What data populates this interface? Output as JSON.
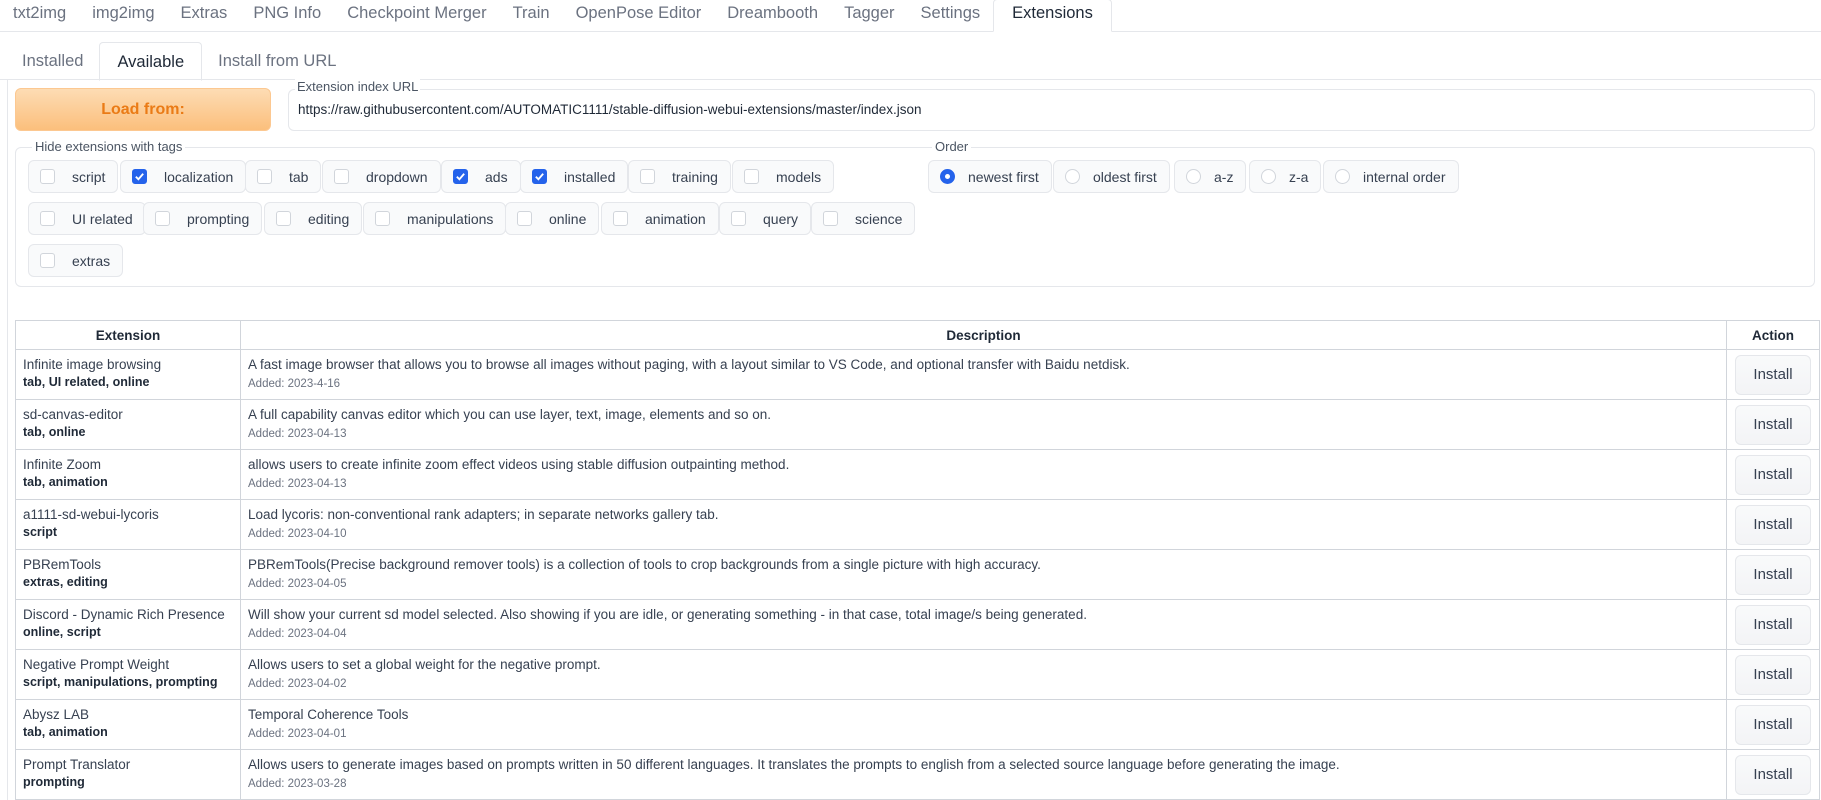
{
  "top_tabs": [
    "txt2img",
    "img2img",
    "Extras",
    "PNG Info",
    "Checkpoint Merger",
    "Train",
    "OpenPose Editor",
    "Dreambooth",
    "Tagger",
    "Settings",
    "Extensions"
  ],
  "active_top_tab": "Extensions",
  "sub_tabs": [
    "Installed",
    "Available",
    "Install from URL"
  ],
  "active_sub_tab": "Available",
  "load_button": "Load from:",
  "url_field": {
    "label": "Extension index URL",
    "value": "https://raw.githubusercontent.com/AUTOMATIC1111/stable-diffusion-webui-extensions/master/index.json"
  },
  "hide_tags": {
    "label": "Hide extensions with tags",
    "items": [
      {
        "label": "script",
        "checked": false
      },
      {
        "label": "localization",
        "checked": true
      },
      {
        "label": "tab",
        "checked": false
      },
      {
        "label": "dropdown",
        "checked": false
      },
      {
        "label": "ads",
        "checked": true
      },
      {
        "label": "installed",
        "checked": true
      },
      {
        "label": "training",
        "checked": false
      },
      {
        "label": "models",
        "checked": false
      },
      {
        "label": "UI related",
        "checked": false
      },
      {
        "label": "prompting",
        "checked": false
      },
      {
        "label": "editing",
        "checked": false
      },
      {
        "label": "manipulations",
        "checked": false
      },
      {
        "label": "online",
        "checked": false
      },
      {
        "label": "animation",
        "checked": false
      },
      {
        "label": "query",
        "checked": false
      },
      {
        "label": "science",
        "checked": false
      },
      {
        "label": "extras",
        "checked": false
      }
    ]
  },
  "order": {
    "label": "Order",
    "options": [
      {
        "label": "newest first",
        "selected": true
      },
      {
        "label": "oldest first",
        "selected": false
      },
      {
        "label": "a-z",
        "selected": false
      },
      {
        "label": "z-a",
        "selected": false
      },
      {
        "label": "internal order",
        "selected": false
      }
    ]
  },
  "table": {
    "headers": [
      "Extension",
      "Description",
      "Action"
    ],
    "install_label": "Install",
    "rows": [
      {
        "name": "Infinite image browsing",
        "tags": "tab, UI related, online",
        "description": "A fast image browser that allows you to browse all images without paging, with a layout similar to VS Code, and optional transfer with Baidu netdisk.",
        "added": "Added: 2023-4-16"
      },
      {
        "name": "sd-canvas-editor",
        "tags": "tab, online",
        "description": "A full capability canvas editor which you can use layer, text, image, elements and so on.",
        "added": "Added: 2023-04-13"
      },
      {
        "name": "Infinite Zoom",
        "tags": "tab, animation",
        "description": "allows users to create infinite zoom effect videos using stable diffusion outpainting method.",
        "added": "Added: 2023-04-13"
      },
      {
        "name": "a1111-sd-webui-lycoris",
        "tags": "script",
        "description": "Load lycoris: non-conventional rank adapters; in separate networks gallery tab.",
        "added": "Added: 2023-04-10"
      },
      {
        "name": "PBRemTools",
        "tags": "extras, editing",
        "description": "PBRemTools(Precise background remover tools) is a collection of tools to crop backgrounds from a single picture with high accuracy.",
        "added": "Added: 2023-04-05"
      },
      {
        "name": "Discord - Dynamic Rich Presence",
        "tags": "online, script",
        "description": "Will show your current sd model selected. Also showing if you are idle, or generating something - in that case, total image/s being generated.",
        "added": "Added: 2023-04-04"
      },
      {
        "name": "Negative Prompt Weight",
        "tags": "script, manipulations, prompting",
        "description": "Allows users to set a global weight for the negative prompt.",
        "added": "Added: 2023-04-02"
      },
      {
        "name": "Abysz LAB",
        "tags": "tab, animation",
        "description": "Temporal Coherence Tools",
        "added": "Added: 2023-04-01"
      },
      {
        "name": "Prompt Translator",
        "tags": "prompting",
        "description": "Allows users to generate images based on prompts written in 50 different languages. It translates the prompts to english from a selected source language before generating the image.",
        "added": "Added: 2023-03-28"
      }
    ]
  }
}
